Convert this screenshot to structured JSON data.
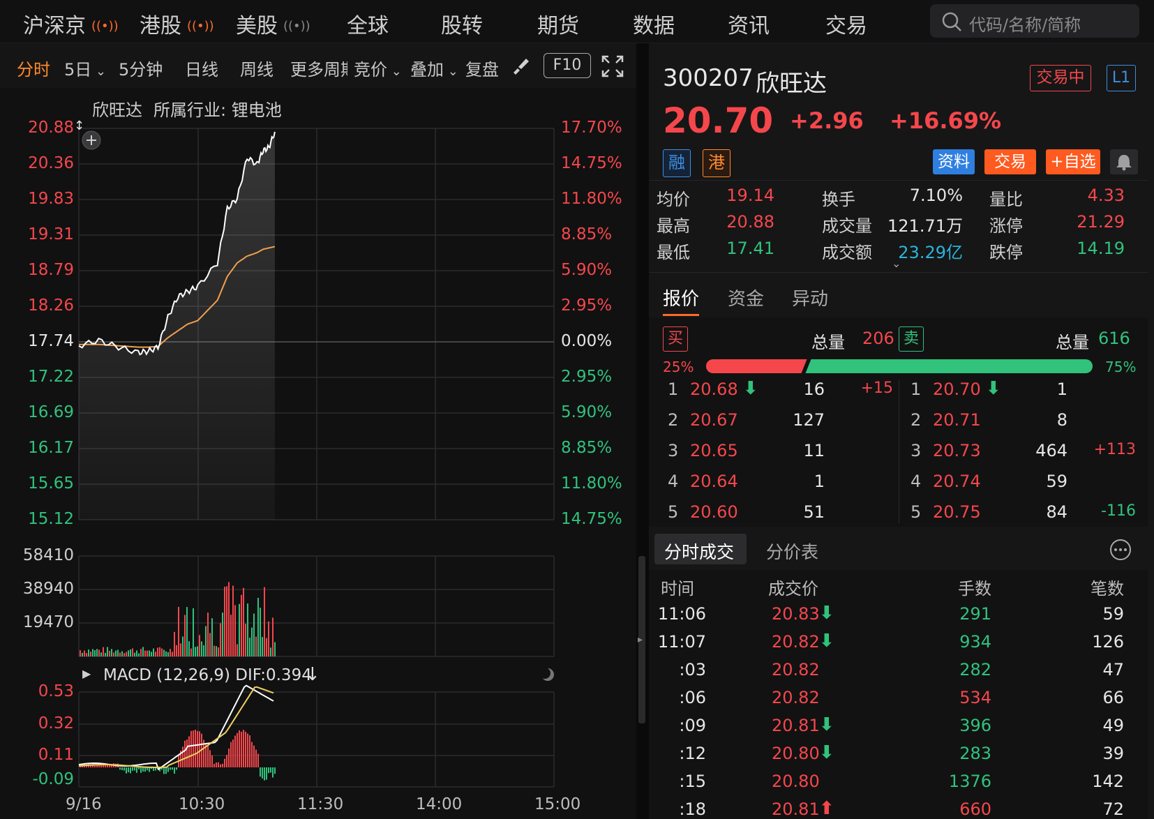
{
  "nav": {
    "items": [
      {
        "label": "沪深京",
        "signal": true,
        "signal_color": "#ff6a2b"
      },
      {
        "label": "港股",
        "signal": true,
        "signal_color": "#ff6a2b"
      },
      {
        "label": "美股",
        "signal": true,
        "signal_color": "#888888"
      },
      {
        "label": "全球",
        "signal": false
      },
      {
        "label": "股转",
        "signal": false
      },
      {
        "label": "期货",
        "signal": false
      },
      {
        "label": "数据",
        "signal": false
      },
      {
        "label": "资讯",
        "signal": false
      },
      {
        "label": "交易",
        "signal": false
      }
    ],
    "search_placeholder": "代码/名称/简称"
  },
  "toolbar": {
    "items": [
      "分时",
      "5日",
      "5分钟",
      "日线",
      "周线",
      "更多周期",
      "竞价",
      "叠加",
      "复盘"
    ],
    "active": "分时",
    "dropdown_items": [
      "5日",
      "竞价",
      "叠加"
    ],
    "f10_label": "F10"
  },
  "chart": {
    "header_name": "欣旺达",
    "header_industry": "所属行业: 锂电池",
    "price_axis_left": [
      "20.88",
      "20.36",
      "19.83",
      "19.31",
      "18.79",
      "18.26",
      "17.74",
      "17.22",
      "16.69",
      "16.17",
      "15.65",
      "15.12"
    ],
    "price_axis_right": [
      "17.70%",
      "14.75%",
      "11.80%",
      "8.85%",
      "5.90%",
      "2.95%",
      "0.00%",
      "2.95%",
      "5.90%",
      "8.85%",
      "11.80%",
      "14.75%"
    ],
    "volume_axis": [
      "58410",
      "38940",
      "19470"
    ],
    "macd_label": "MACD (12,26,9)  DIF:0.394",
    "macd_axis": [
      "0.53",
      "0.32",
      "0.11",
      "-0.09"
    ],
    "time_axis": [
      "9/16",
      "10:30",
      "11:30",
      "14:00",
      "15:00"
    ],
    "colors": {
      "up": "#f5474b",
      "down": "#31c27c",
      "price_line": "#ffffff",
      "avg_line": "#f0a04b"
    }
  },
  "chart_data": {
    "type": "line",
    "title": "欣旺达 所属行业: 锂电池",
    "prev_close": 17.74,
    "ylim": [
      15.12,
      20.88
    ],
    "x": [
      "9:30",
      "9:40",
      "9:50",
      "10:00",
      "10:05",
      "10:10",
      "10:15",
      "10:20",
      "10:25",
      "10:30",
      "10:40",
      "10:45",
      "10:50",
      "10:55",
      "11:00",
      "11:03",
      "11:06",
      "11:09"
    ],
    "series": [
      {
        "values": [
          17.68,
          17.76,
          17.66,
          17.58,
          17.6,
          17.66,
          18.1,
          18.4,
          18.48,
          18.55,
          18.9,
          19.7,
          19.85,
          20.45,
          20.35,
          20.55,
          20.6,
          20.83
        ]
      },
      {
        "values": [
          17.7,
          17.7,
          17.68,
          17.66,
          17.66,
          17.67,
          17.8,
          17.9,
          18.0,
          18.05,
          18.35,
          18.7,
          18.9,
          19.0,
          19.05,
          19.1,
          19.12,
          19.14
        ]
      }
    ]
  },
  "stock": {
    "code": "300207",
    "name": "欣旺达",
    "status_badge": "交易中",
    "level_badge": "L1",
    "price": "20.70",
    "change": "+2.96",
    "change_pct": "+16.69%",
    "tag_margin": "融",
    "tag_hk": "港",
    "btn_profile": "资料",
    "btn_trade": "交易",
    "btn_watch": "+自选"
  },
  "stats": [
    {
      "label": "均价",
      "value": "19.14",
      "color": "red"
    },
    {
      "label": "换手",
      "value": "7.10%",
      "color": "white"
    },
    {
      "label": "量比",
      "value": "4.33",
      "color": "red"
    },
    {
      "label": "最高",
      "value": "20.88",
      "color": "red"
    },
    {
      "label": "成交量",
      "value": "121.71万",
      "color": "white"
    },
    {
      "label": "涨停",
      "value": "21.29",
      "color": "red"
    },
    {
      "label": "最低",
      "value": "17.41",
      "color": "green"
    },
    {
      "label": "成交额",
      "value": "23.29亿",
      "color": "cyan"
    },
    {
      "label": "跌停",
      "value": "14.19",
      "color": "green"
    }
  ],
  "quote_tabs": [
    "报价",
    "资金",
    "异动"
  ],
  "orderbook": {
    "buy_label": "买",
    "sell_label": "卖",
    "total_label": "总量",
    "buy_total": "206",
    "sell_total": "616",
    "buy_pct": "25%",
    "sell_pct": "75%",
    "buy_ratio": 0.25,
    "bids": [
      {
        "lvl": "1",
        "price": "20.68",
        "arrow": "down",
        "vol": "16",
        "delta": "+15",
        "delta_color": "red"
      },
      {
        "lvl": "2",
        "price": "20.67",
        "arrow": "",
        "vol": "127",
        "delta": "",
        "delta_color": ""
      },
      {
        "lvl": "3",
        "price": "20.65",
        "arrow": "",
        "vol": "11",
        "delta": "",
        "delta_color": ""
      },
      {
        "lvl": "4",
        "price": "20.64",
        "arrow": "",
        "vol": "1",
        "delta": "",
        "delta_color": ""
      },
      {
        "lvl": "5",
        "price": "20.60",
        "arrow": "",
        "vol": "51",
        "delta": "",
        "delta_color": ""
      }
    ],
    "asks": [
      {
        "lvl": "1",
        "price": "20.70",
        "arrow": "down",
        "vol": "1",
        "delta": "",
        "delta_color": ""
      },
      {
        "lvl": "2",
        "price": "20.71",
        "arrow": "",
        "vol": "8",
        "delta": "",
        "delta_color": ""
      },
      {
        "lvl": "3",
        "price": "20.73",
        "arrow": "",
        "vol": "464",
        "delta": "+113",
        "delta_color": "red"
      },
      {
        "lvl": "4",
        "price": "20.74",
        "arrow": "",
        "vol": "59",
        "delta": "",
        "delta_color": ""
      },
      {
        "lvl": "5",
        "price": "20.75",
        "arrow": "",
        "vol": "84",
        "delta": "-116",
        "delta_color": "green"
      }
    ]
  },
  "trades": {
    "tabs": [
      "分时成交",
      "分价表"
    ],
    "headers": [
      "时间",
      "成交价",
      "手数",
      "笔数"
    ],
    "rows": [
      {
        "time": "11:06",
        "price": "20.83",
        "arrow": "down",
        "vol": "291",
        "vol_color": "green",
        "count": "59"
      },
      {
        "time": "11:07",
        "price": "20.82",
        "arrow": "down",
        "vol": "934",
        "vol_color": "green",
        "count": "126"
      },
      {
        "time": ":03",
        "price": "20.82",
        "arrow": "",
        "vol": "282",
        "vol_color": "green",
        "count": "47"
      },
      {
        "time": ":06",
        "price": "20.82",
        "arrow": "",
        "vol": "534",
        "vol_color": "red",
        "count": "66"
      },
      {
        "time": ":09",
        "price": "20.81",
        "arrow": "down",
        "vol": "396",
        "vol_color": "green",
        "count": "49"
      },
      {
        "time": ":12",
        "price": "20.80",
        "arrow": "down",
        "vol": "283",
        "vol_color": "green",
        "count": "39"
      },
      {
        "time": ":15",
        "price": "20.80",
        "arrow": "",
        "vol": "1376",
        "vol_color": "green",
        "count": "142"
      },
      {
        "time": ":18",
        "price": "20.81",
        "arrow": "up",
        "vol": "660",
        "vol_color": "red",
        "count": "72"
      }
    ]
  }
}
